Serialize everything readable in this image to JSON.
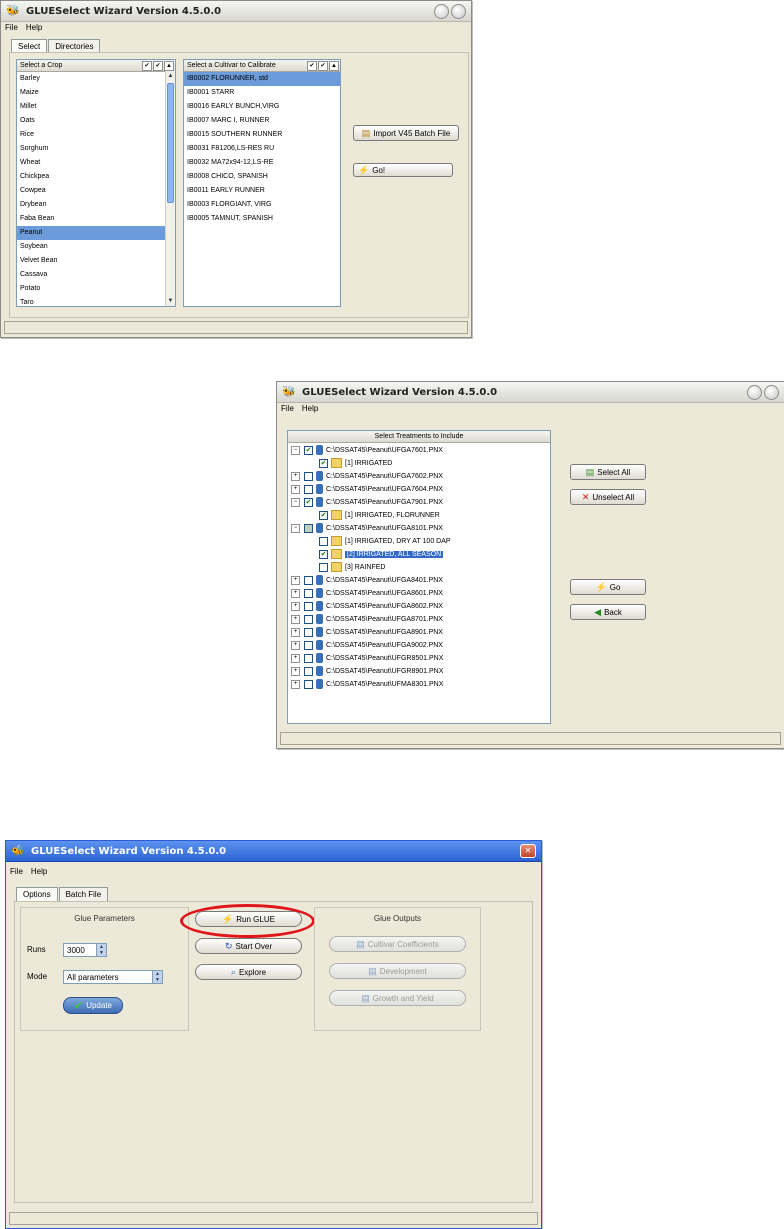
{
  "win1": {
    "title": "GLUESelect Wizard Version 4.5.0.0",
    "menu": [
      "File",
      "Help"
    ],
    "tabs": [
      "Select",
      "Directories"
    ],
    "crop_list": {
      "header": "Select a Crop",
      "items": [
        "Barley",
        "Maize",
        "Millet",
        "Oats",
        "Rice",
        "Sorghum",
        "Wheat",
        "Chickpea",
        "Cowpea",
        "Drybean",
        "Faba Bean",
        "Peanut",
        "Soybean",
        "Velvet Bean",
        "Cassava",
        "Potato",
        "Taro"
      ],
      "selected": "Peanut"
    },
    "cultivar_list": {
      "header": "Select a Cultivar to Calibrate",
      "items": [
        "IB0002 FLORUNNER, std",
        "IB0001 STARR",
        "IB0016 EARLY BUNCH,VIRG",
        "IB0007 MARC I, RUNNER",
        "IB0015 SOUTHERN RUNNER",
        "IB0031 F81206,LS-RES RU",
        "IB0032 MA72x94-12,LS-RE",
        "IB0008 CHICO, SPANISH",
        "IB0011 EARLY RUNNER",
        "IB0003 FLORGIANT, VIRG",
        "IB0005 TAMNUT, SPANISH"
      ],
      "selected": "IB0002 FLORUNNER, std"
    },
    "import_button": "Import V45 Batch File",
    "go_button": "Go!"
  },
  "win2": {
    "title": "GLUESelect Wizard Version 4.5.0.0",
    "menu": [
      "File",
      "Help"
    ],
    "tree_header": "Select Treatments to Include",
    "rows": [
      {
        "text": "C:\\DSSAT45\\Peanut\\UFGA7601.PNX",
        "level": 0,
        "exp": "−",
        "check": "checked",
        "icon": "db"
      },
      {
        "text": "[1] IRRIGATED",
        "level": 1,
        "exp": "",
        "check": "checked",
        "icon": "folder"
      },
      {
        "text": "C:\\DSSAT45\\Peanut\\UFGA7602.PNX",
        "level": 0,
        "exp": "+",
        "check": "none",
        "icon": "db"
      },
      {
        "text": "C:\\DSSAT45\\Peanut\\UFGA7604.PNX",
        "level": 0,
        "exp": "+",
        "check": "none",
        "icon": "db"
      },
      {
        "text": "C:\\DSSAT45\\Peanut\\UFGA7901.PNX",
        "level": 0,
        "exp": "−",
        "check": "checked",
        "icon": "db"
      },
      {
        "text": "[1] IRRIGATED, FLORUNNER",
        "level": 1,
        "exp": "",
        "check": "checked",
        "icon": "folder"
      },
      {
        "text": "C:\\DSSAT45\\Peanut\\UFGA8101.PNX",
        "level": 0,
        "exp": "−",
        "check": "partial",
        "icon": "db"
      },
      {
        "text": "[1] IRRIGATED, DRY AT 100 DAP",
        "level": 1,
        "exp": "",
        "check": "none",
        "icon": "folder"
      },
      {
        "text": "[2] IRRIGATED, ALL SEASON",
        "level": 1,
        "exp": "",
        "check": "checked",
        "icon": "folder",
        "selected": true
      },
      {
        "text": "[3] RAINFED",
        "level": 1,
        "exp": "",
        "check": "none",
        "icon": "folder"
      },
      {
        "text": "C:\\DSSAT45\\Peanut\\UFGA8401.PNX",
        "level": 0,
        "exp": "+",
        "check": "none",
        "icon": "db"
      },
      {
        "text": "C:\\DSSAT45\\Peanut\\UFGA8601.PNX",
        "level": 0,
        "exp": "+",
        "check": "none",
        "icon": "db"
      },
      {
        "text": "C:\\DSSAT45\\Peanut\\UFGA8602.PNX",
        "level": 0,
        "exp": "+",
        "check": "none",
        "icon": "db"
      },
      {
        "text": "C:\\DSSAT45\\Peanut\\UFGA8701.PNX",
        "level": 0,
        "exp": "+",
        "check": "none",
        "icon": "db"
      },
      {
        "text": "C:\\DSSAT45\\Peanut\\UFGA8901.PNX",
        "level": 0,
        "exp": "+",
        "check": "none",
        "icon": "db"
      },
      {
        "text": "C:\\DSSAT45\\Peanut\\UFGA9002.PNX",
        "level": 0,
        "exp": "+",
        "check": "none",
        "icon": "db"
      },
      {
        "text": "C:\\DSSAT45\\Peanut\\UFGR8501.PNX",
        "level": 0,
        "exp": "+",
        "check": "none",
        "icon": "db"
      },
      {
        "text": "C:\\DSSAT45\\Peanut\\UFGR8901.PNX",
        "level": 0,
        "exp": "+",
        "check": "none",
        "icon": "db"
      },
      {
        "text": "C:\\DSSAT45\\Peanut\\UFMA8301.PNX",
        "level": 0,
        "exp": "+",
        "check": "none",
        "icon": "db"
      }
    ],
    "select_all": "Select All",
    "unselect_all": "Unselect All",
    "go": "Go",
    "back": "Back"
  },
  "win3": {
    "title": "GLUESelect Wizard Version 4.5.0.0",
    "menu": [
      "File",
      "Help"
    ],
    "tabs": [
      "Options",
      "Batch File"
    ],
    "glue_parameters": {
      "title": "Glue Parameters",
      "runs_label": "Runs",
      "runs_value": "3000",
      "mode_label": "Mode",
      "mode_value": "All parameters",
      "update": "Update"
    },
    "run_glue": "Run GLUE",
    "start_over": "Start Over",
    "explore": "Explore",
    "glue_outputs": {
      "title": "Glue Outputs",
      "buttons": [
        "Cultivar Coefficients",
        "Development",
        "Growth and Yield"
      ]
    }
  }
}
